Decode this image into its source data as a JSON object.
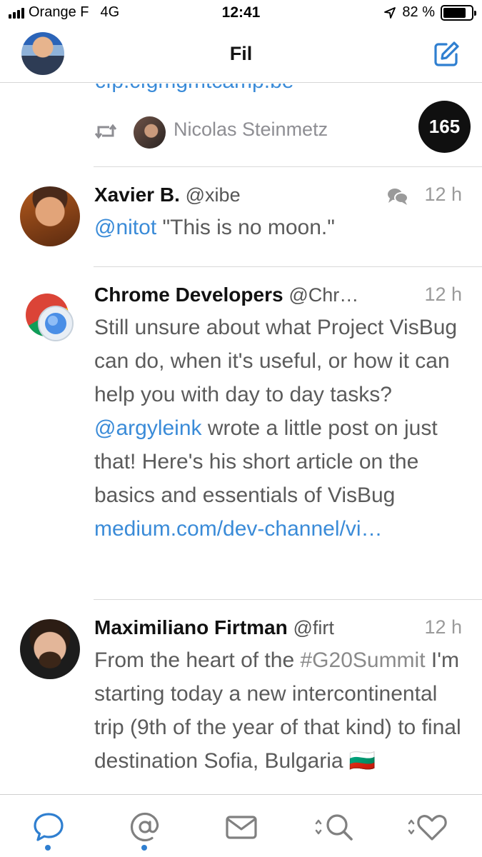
{
  "status_bar": {
    "carrier": "Orange F",
    "network": "4G",
    "time": "12:41",
    "battery_percent": "82 %",
    "battery_level": 0.82
  },
  "nav": {
    "title": "Fil"
  },
  "partial_tweet": {
    "link_text": "cfp.cfgmgmtcamp.be",
    "retweeted_by": "Nicolas Steinmetz"
  },
  "unread_count": "165",
  "tweets": [
    {
      "name": "Xavier B.",
      "handle": "@xibe",
      "time": "12 h",
      "mention": "@nitot",
      "text": " \"This is no moon.\""
    },
    {
      "name": "Chrome Developers",
      "handle": "@Chr…",
      "time": "12 h",
      "text_before": "Still unsure about what Project VisBug can do, when it's useful, or how it can help you with day to day tasks? ",
      "mention": "@argyleink",
      "text_after": " wrote a little post on just that! Here's his short article on the basics and essentials of VisBug ",
      "link": "medium.com/dev-channel/vi…"
    },
    {
      "name": "Maximiliano Firtman",
      "handle": "@firt",
      "time": "12 h",
      "text_before": "From the heart of the ",
      "hashtag": "#G20Summit",
      "text_after": " I'm starting today a new intercontinental trip (9th of the year of that kind) to final destination Sofia, Bulgaria 🇧🇬"
    }
  ],
  "tabbar": {
    "tabs": [
      "timeline",
      "mentions",
      "messages",
      "search",
      "likes"
    ]
  },
  "colors": {
    "accent": "#2f7fd0",
    "link": "#3a8bd8",
    "badge": "#101010"
  }
}
